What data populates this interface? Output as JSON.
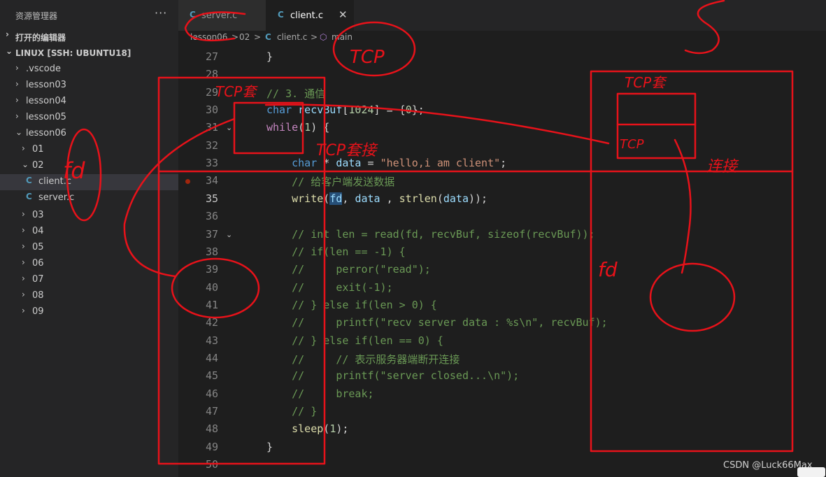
{
  "sidebar": {
    "title": "资源管理器",
    "more": "···",
    "sections": {
      "open_editors": "打开的编辑器",
      "workspace": "LINUX [SSH: UBUNTU18]"
    },
    "tree": [
      {
        "label": ".vscode"
      },
      {
        "label": "lesson03"
      },
      {
        "label": "lesson04"
      },
      {
        "label": "lesson05"
      },
      {
        "label": "lesson06"
      },
      {
        "label": "01"
      },
      {
        "label": "02"
      },
      {
        "label": "client.c"
      },
      {
        "label": "server.c"
      },
      {
        "label": "03"
      },
      {
        "label": "04"
      },
      {
        "label": "05"
      },
      {
        "label": "06"
      },
      {
        "label": "07"
      },
      {
        "label": "08"
      },
      {
        "label": "09"
      }
    ]
  },
  "tabs": [
    {
      "label": "server.c"
    },
    {
      "label": "client.c"
    }
  ],
  "breadcrumb": {
    "p1": "lesson06",
    "sep": ">",
    "p2": "02",
    "p3": "client.c",
    "p4": "main"
  },
  "editor": {
    "lines": [
      "27",
      "28",
      "29",
      "30",
      "31",
      "32",
      "33",
      "34",
      "35",
      "36",
      "37",
      "38",
      "39",
      "40",
      "41",
      "42",
      "43",
      "44",
      "45",
      "46",
      "47",
      "48",
      "49",
      "50"
    ]
  },
  "annotations": [
    "TCP",
    "TCP套",
    "TCP套接",
    "fd",
    "fd",
    "TCP",
    "TCP套",
    "连接"
  ],
  "watermark": "CSDN @Luck66Max",
  "colors": {
    "annotation_red": "#e8121a",
    "keyword": "#569cd6",
    "function": "#dcdcaa",
    "string": "#ce9178",
    "comment": "#6a9955"
  }
}
